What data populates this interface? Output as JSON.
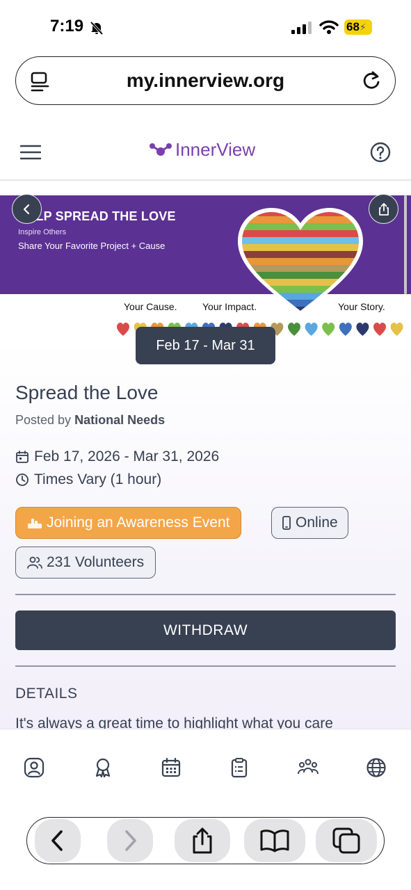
{
  "status_bar": {
    "time": "7:19",
    "battery": "68"
  },
  "browser": {
    "url": "my.innerview.org"
  },
  "header": {
    "logo": "InnerView"
  },
  "banner": {
    "title": "HELP SPREAD THE LOVE",
    "subtitle": "Inspire Others",
    "tagline": "Share Your Favorite Project + Cause",
    "labels": [
      "Your Cause.",
      "Your Impact.",
      "Your Story."
    ],
    "heart_colors": [
      "#d94b4b",
      "#e8973b",
      "#e6c14a",
      "#7cbf4f",
      "#4a8f3c",
      "#5aa7e0",
      "#3f6fbf",
      "#2c3a6b"
    ]
  },
  "event": {
    "date_badge": "Feb 17 - Mar 31",
    "title": "Spread the Love",
    "posted_prefix": "Posted by",
    "posted_by": "National Needs",
    "dates": "Feb 17, 2026 - Mar 31, 2026",
    "time": "Times Vary (1 hour)",
    "category": "Joining an Awareness Event",
    "location": "Online",
    "volunteers": "231 Volunteers"
  },
  "actions": {
    "withdraw": "WITHDRAW"
  },
  "details": {
    "heading": "DETAILS",
    "text": "It's always a great time to highlight what you care"
  },
  "colors": {
    "brand": "#7b3fb0",
    "banner": "#5b3193",
    "primary_dark": "#384152",
    "category_chip": "#f3a648"
  }
}
